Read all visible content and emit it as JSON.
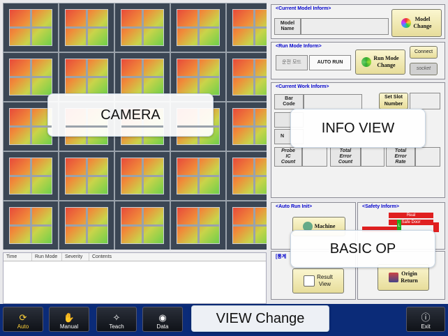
{
  "camera": {
    "overlay_label": "CAMERA"
  },
  "log": {
    "columns": [
      "Time",
      "Run Mode",
      "Severity",
      "Contents"
    ]
  },
  "model_panel": {
    "title": "<Current Model Inform>",
    "model_name_label": "Model\nName",
    "model_name_value": "",
    "model_change_label": "Model\nChange"
  },
  "run_mode_panel": {
    "title": "<Run Mode Inform>",
    "mode_korean": "운전 모드",
    "mode_value": "AUTO RUN",
    "run_mode_change_label": "Run Mode\nChange",
    "connect_label": "Connect",
    "socket_label": "socket"
  },
  "work_panel": {
    "title": "<Current Work Inform>",
    "bar_code_label": "Bar\nCode",
    "set_slot_label": "Set Slot\nNumber",
    "probe_ic_label": "Probe\nIC\nCount",
    "total_error_count_label": "Total\nError\nCount",
    "total_error_rate_label": "Total\nError\nRate",
    "partial_n": "N"
  },
  "info_overlay_label": "INFO VIEW",
  "auto_run_panel": {
    "title": "<Auto Run Init>",
    "machine_label": "Machine"
  },
  "safety_panel": {
    "title": "<Safety Inform>",
    "real_label": "Real",
    "safe_door_label": "Safe Door",
    "l_label": "L"
  },
  "basic_op_overlay_label": "BASIC OP",
  "stats_panel": {
    "title": "[통계",
    "result_view_label": "Result\nView",
    "origin_return_label": "Origin\nReturn"
  },
  "bottom_nav": {
    "auto": "Auto",
    "manual": "Manual",
    "teach": "Teach",
    "data": "Data",
    "exit": "Exit"
  },
  "view_change_overlay_label": "VIEW Change",
  "colors": {
    "bottom_bar": "#0b2b78",
    "panel_title": "#0000cc",
    "button_gold": "#e7dd9a",
    "active_nav": "#ffd23a"
  }
}
